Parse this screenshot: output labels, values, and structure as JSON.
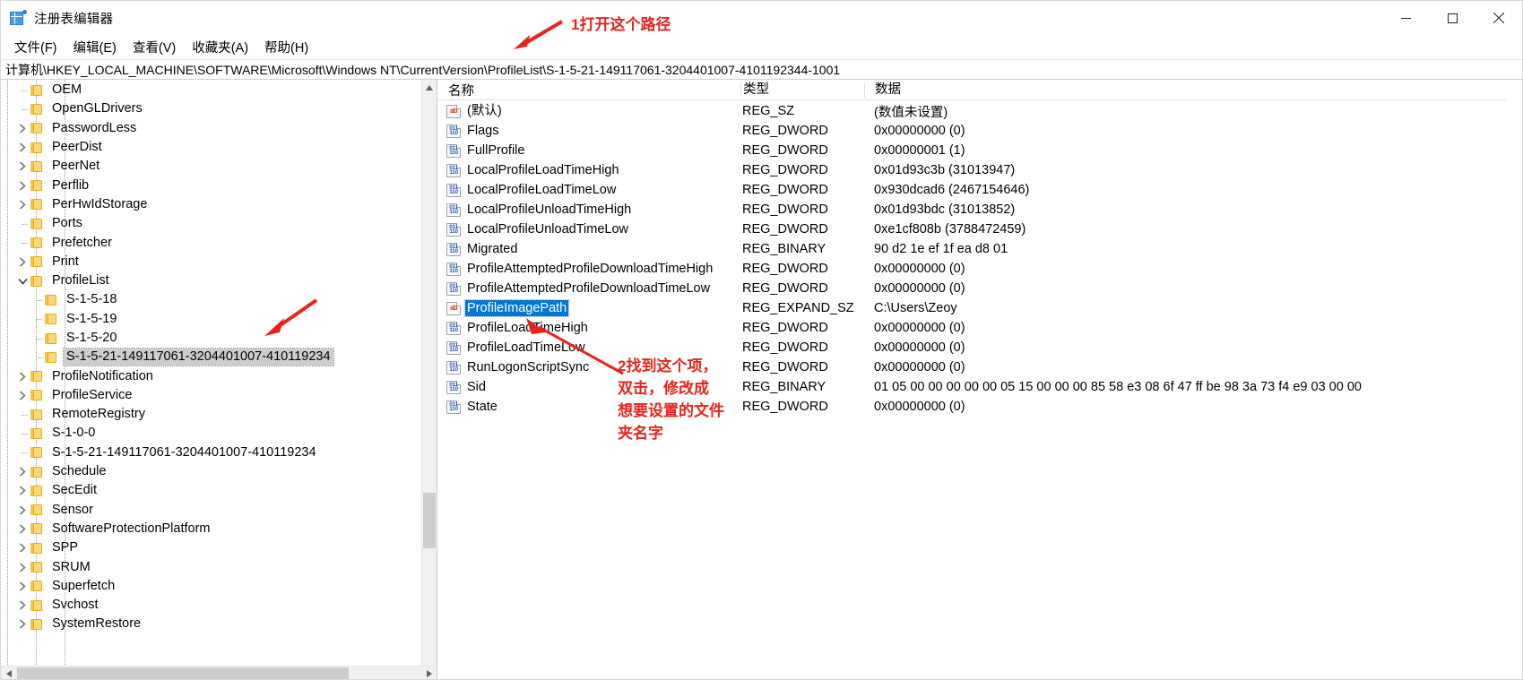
{
  "window": {
    "title": "注册表编辑器",
    "icon": "registry-editor-icon",
    "controls": {
      "minimize": "–",
      "maximize": "□",
      "close": "✕"
    }
  },
  "menubar": {
    "items": [
      {
        "label": "文件(F)",
        "name": "menu-file"
      },
      {
        "label": "编辑(E)",
        "name": "menu-edit"
      },
      {
        "label": "查看(V)",
        "name": "menu-view"
      },
      {
        "label": "收藏夹(A)",
        "name": "menu-favorites"
      },
      {
        "label": "帮助(H)",
        "name": "menu-help"
      }
    ]
  },
  "address": {
    "path": "计算机\\HKEY_LOCAL_MACHINE\\SOFTWARE\\Microsoft\\Windows NT\\CurrentVersion\\ProfileList\\S-1-5-21-149117061-3204401007-4101192344-1001"
  },
  "tree": {
    "items": [
      {
        "label": "OEM",
        "indent": 2,
        "twisty": "none",
        "selected": false
      },
      {
        "label": "OpenGLDrivers",
        "indent": 2,
        "twisty": "none",
        "selected": false
      },
      {
        "label": "PasswordLess",
        "indent": 2,
        "twisty": "collapsed",
        "selected": false
      },
      {
        "label": "PeerDist",
        "indent": 2,
        "twisty": "collapsed",
        "selected": false
      },
      {
        "label": "PeerNet",
        "indent": 2,
        "twisty": "collapsed",
        "selected": false
      },
      {
        "label": "Perflib",
        "indent": 2,
        "twisty": "collapsed",
        "selected": false
      },
      {
        "label": "PerHwIdStorage",
        "indent": 2,
        "twisty": "collapsed",
        "selected": false
      },
      {
        "label": "Ports",
        "indent": 2,
        "twisty": "none",
        "selected": false
      },
      {
        "label": "Prefetcher",
        "indent": 2,
        "twisty": "none",
        "selected": false
      },
      {
        "label": "Print",
        "indent": 2,
        "twisty": "collapsed",
        "selected": false
      },
      {
        "label": "ProfileList",
        "indent": 2,
        "twisty": "expanded",
        "selected": false
      },
      {
        "label": "S-1-5-18",
        "indent": 3,
        "twisty": "none",
        "selected": false
      },
      {
        "label": "S-1-5-19",
        "indent": 3,
        "twisty": "none",
        "selected": false
      },
      {
        "label": "S-1-5-20",
        "indent": 3,
        "twisty": "none",
        "selected": false
      },
      {
        "label": "S-1-5-21-149117061-3204401007-410119234",
        "indent": 3,
        "twisty": "none",
        "selected": true
      },
      {
        "label": "ProfileNotification",
        "indent": 2,
        "twisty": "collapsed",
        "selected": false
      },
      {
        "label": "ProfileService",
        "indent": 2,
        "twisty": "collapsed",
        "selected": false
      },
      {
        "label": "RemoteRegistry",
        "indent": 2,
        "twisty": "none",
        "selected": false
      },
      {
        "label": "S-1-0-0",
        "indent": 2,
        "twisty": "none",
        "selected": false
      },
      {
        "label": "S-1-5-21-149117061-3204401007-410119234",
        "indent": 2,
        "twisty": "none",
        "selected": false
      },
      {
        "label": "Schedule",
        "indent": 2,
        "twisty": "collapsed",
        "selected": false
      },
      {
        "label": "SecEdit",
        "indent": 2,
        "twisty": "collapsed",
        "selected": false
      },
      {
        "label": "Sensor",
        "indent": 2,
        "twisty": "collapsed",
        "selected": false
      },
      {
        "label": "SoftwareProtectionPlatform",
        "indent": 2,
        "twisty": "collapsed",
        "selected": false
      },
      {
        "label": "SPP",
        "indent": 2,
        "twisty": "collapsed",
        "selected": false
      },
      {
        "label": "SRUM",
        "indent": 2,
        "twisty": "collapsed",
        "selected": false
      },
      {
        "label": "Superfetch",
        "indent": 2,
        "twisty": "collapsed",
        "selected": false
      },
      {
        "label": "Svchost",
        "indent": 2,
        "twisty": "collapsed",
        "selected": false
      },
      {
        "label": "SystemRestore",
        "indent": 2,
        "twisty": "collapsed",
        "selected": false
      }
    ]
  },
  "list": {
    "columns": {
      "name": "名称",
      "type": "类型",
      "data": "数据"
    },
    "rows": [
      {
        "name": "(默认)",
        "type": "REG_SZ",
        "data": "(数值未设置)",
        "icon": "string-value-icon",
        "selected": false
      },
      {
        "name": "Flags",
        "type": "REG_DWORD",
        "data": "0x00000000 (0)",
        "icon": "binary-value-icon",
        "selected": false
      },
      {
        "name": "FullProfile",
        "type": "REG_DWORD",
        "data": "0x00000001 (1)",
        "icon": "binary-value-icon",
        "selected": false
      },
      {
        "name": "LocalProfileLoadTimeHigh",
        "type": "REG_DWORD",
        "data": "0x01d93c3b (31013947)",
        "icon": "binary-value-icon",
        "selected": false
      },
      {
        "name": "LocalProfileLoadTimeLow",
        "type": "REG_DWORD",
        "data": "0x930dcad6 (2467154646)",
        "icon": "binary-value-icon",
        "selected": false
      },
      {
        "name": "LocalProfileUnloadTimeHigh",
        "type": "REG_DWORD",
        "data": "0x01d93bdc (31013852)",
        "icon": "binary-value-icon",
        "selected": false
      },
      {
        "name": "LocalProfileUnloadTimeLow",
        "type": "REG_DWORD",
        "data": "0xe1cf808b (3788472459)",
        "icon": "binary-value-icon",
        "selected": false
      },
      {
        "name": "Migrated",
        "type": "REG_BINARY",
        "data": "90 d2 1e ef 1f ea d8 01",
        "icon": "binary-value-icon",
        "selected": false
      },
      {
        "name": "ProfileAttemptedProfileDownloadTimeHigh",
        "type": "REG_DWORD",
        "data": "0x00000000 (0)",
        "icon": "binary-value-icon",
        "selected": false
      },
      {
        "name": "ProfileAttemptedProfileDownloadTimeLow",
        "type": "REG_DWORD",
        "data": "0x00000000 (0)",
        "icon": "binary-value-icon",
        "selected": false
      },
      {
        "name": "ProfileImagePath",
        "type": "REG_EXPAND_SZ",
        "data": "C:\\Users\\Zeoy",
        "icon": "string-value-icon",
        "selected": true
      },
      {
        "name": "ProfileLoadTimeHigh",
        "type": "REG_DWORD",
        "data": "0x00000000 (0)",
        "icon": "binary-value-icon",
        "selected": false
      },
      {
        "name": "ProfileLoadTimeLow",
        "type": "REG_DWORD",
        "data": "0x00000000 (0)",
        "icon": "binary-value-icon",
        "selected": false
      },
      {
        "name": "RunLogonScriptSync",
        "type": "REG_DWORD",
        "data": "0x00000000 (0)",
        "icon": "binary-value-icon",
        "selected": false
      },
      {
        "name": "Sid",
        "type": "REG_BINARY",
        "data": "01 05 00 00 00 00 00 05 15 00 00 00 85 58 e3 08 6f 47 ff be 98 3a 73 f4 e9 03 00 00",
        "icon": "binary-value-icon",
        "selected": false
      },
      {
        "name": "State",
        "type": "REG_DWORD",
        "data": "0x00000000 (0)",
        "icon": "binary-value-icon",
        "selected": false
      }
    ]
  },
  "annotations": {
    "color": "#e8231c",
    "note1": "1打开这个路径",
    "note2": "2找到这个项，\n双击，修改成\n想要设置的文件\n夹名字"
  }
}
